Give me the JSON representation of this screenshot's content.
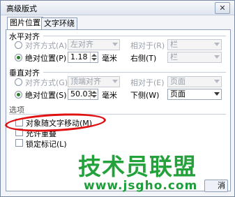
{
  "window": {
    "title": "高级版式",
    "close_glyph": "✕"
  },
  "tabs": [
    {
      "label": "图片位置",
      "active": true
    },
    {
      "label": "文字环绕",
      "active": false
    }
  ],
  "horizontal": {
    "section_label": "水平对齐",
    "align_label": "对齐方式(A)",
    "align_value": "左对齐",
    "relative_label": "相对于(R)",
    "relative_value": "栏",
    "absolute_label": "绝对位置(P)",
    "absolute_value": "1.18",
    "unit": "毫米",
    "right_of_label": "右侧(T)",
    "right_of_value": "栏"
  },
  "vertical": {
    "section_label": "垂直对齐",
    "align_label": "对齐方式(G)",
    "align_value": "顶端对齐",
    "relative_label": "相对于(E)",
    "relative_value": "页面",
    "absolute_label": "绝对位置(S)",
    "absolute_value": "50.03",
    "unit": "毫米",
    "below_label": "下侧(W)",
    "below_value": "页面"
  },
  "options": {
    "section_label": "选项",
    "move_with_text": "对象随文字移动(M)",
    "allow_overlap": "允许重叠",
    "lock_anchor": "锁定标记(L)"
  },
  "buttons": {
    "cancel": "消"
  },
  "watermark": {
    "main": "技术员联盟",
    "url": "www.jsgho.com"
  },
  "colors": {
    "annotation_red": "#e01010",
    "watermark_green": "#23a23c",
    "radio_dot": "#2a7c2a"
  }
}
